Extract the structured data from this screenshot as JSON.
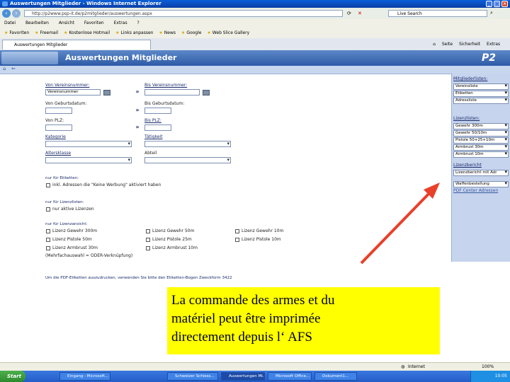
{
  "browser": {
    "window_title": "Auswertungen Mitglieder - Windows Internet Explorer",
    "address": "http://p2www.psp-it.de/p2mitglieder/auswertungen.aspx",
    "search_placeholder": "Live Search",
    "menu": [
      "Datei",
      "Bearbeiten",
      "Ansicht",
      "Favoriten",
      "Extras",
      "?"
    ],
    "favorites_label": "Favoriten",
    "favorites": [
      "Freemail",
      "Kostenlose Hotmail",
      "Links anpassen",
      "News",
      "Google",
      "Web Slice Gallery"
    ],
    "tab_title": "Auswertungen Mitglieder",
    "tools": [
      "Seite",
      "Sicherheit",
      "Extras"
    ],
    "status_zone": "Internet",
    "zoom": "100%"
  },
  "app": {
    "title": "Auswertungen Mitglieder",
    "logo": "P2"
  },
  "form": {
    "von_vereinsnummer": "Von Vereinsnummer:",
    "von_vereinsnummer_value": "Vereinsnummer",
    "bis_vereinsnummer": "Bis Vereinsnummer:",
    "von_geburtsdatum": "Von Geburtsdatum:",
    "bis_geburtsdatum": "Bis Geburtsdatum:",
    "von_plz": "Von PLZ:",
    "bis_plz": "Bis PLZ:",
    "kategorie": "Kategorie",
    "taetigkeit": "Tätigkeit",
    "altersklasse": "Altersklasse",
    "abteil": "Abteil",
    "copy_arrow": "»",
    "nur_etiketten": "nur für Etiketten:",
    "inkl_adressen": "inkl. Adressen die \"Keine Werbung\" aktiviert haben",
    "nur_lizenzlisten": "nur für Lizenzlisten:",
    "nur_aktive_lizenzen": "nur aktive Lizenzen",
    "nur_lizenzansicht": "nur für Lizenzansicht:",
    "lizenzen": [
      [
        "Lizenz Gewehr 300m",
        "Lizenz Gewehr 50m",
        "Lizenz Gewehr 10m"
      ],
      [
        "Lizenz Pistole 50m",
        "Lizenz Pistole 25m",
        "Lizenz Pistole 10m"
      ],
      [
        "Lizenz Armbrust 30m",
        "Lizenz Armbrust 10m",
        ""
      ]
    ],
    "mehrfach_note": "(Mehrfachauswahl = ODER-Verknüpfung)",
    "pdf_note": "Um die PDF-Etiketten auszudrucken, verwenden Sie bitte den Etiketten-Bogen Zweckform 3422"
  },
  "panel": {
    "mitgliederlisten": "Mitgliederlisten:",
    "mitglieder_items": [
      "Vereinsliste",
      "Etiketten",
      "Adressliste"
    ],
    "lizenzlisten": "Lizenzlisten:",
    "lizenz_items": [
      "Gewehr 300m",
      "Gewehr 50/10m",
      "Pistole 50+25+10m",
      "Armbrust 30m",
      "Armbrust 10m"
    ],
    "lizenzbericht": "Lizenzbericht",
    "lizenzbericht_item": "Lizenzbericht mit Adr",
    "waffenbestellung": "Waffenbestellung",
    "pdf_adressen": "PDF Center Adressen"
  },
  "caption": {
    "lines": [
      "La commande des armes et du",
      "matériel peut être imprimée",
      "directement depuis l‘ AFS"
    ]
  },
  "taskbar": {
    "start": "Start",
    "tasks": [
      "Eingang - Microsoft...",
      "Schweizer Schiess...",
      "Auswertungen Mi...",
      "Microsoft Office...",
      "Dokument1..."
    ],
    "clock": "10:05"
  },
  "colors": {
    "arrow": "#e8402a",
    "caption_bg": "#ffff00",
    "header": "#2d5aa6"
  }
}
